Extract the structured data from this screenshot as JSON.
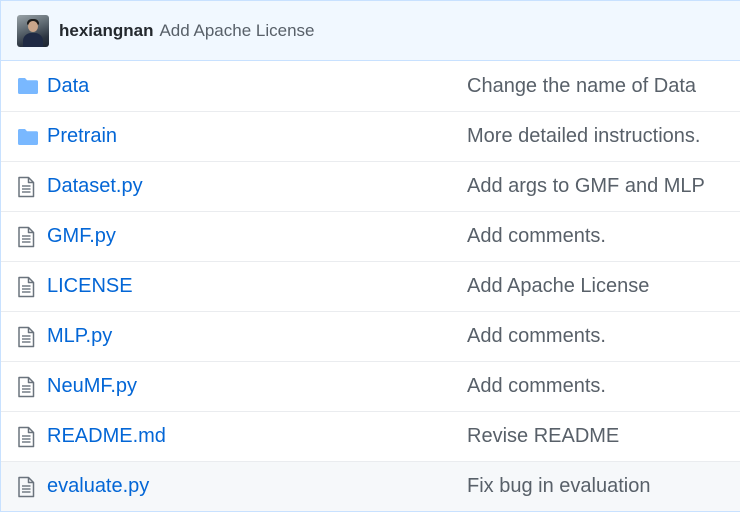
{
  "commit": {
    "author": "hexiangnan",
    "message": "Add Apache License"
  },
  "colors": {
    "link": "#0366d6",
    "folder_icon": "#79b8ff",
    "file_icon": "#6a737d",
    "header_bg": "#f1f8ff"
  },
  "files": [
    {
      "name": "Data",
      "type": "folder",
      "icon": "folder-icon",
      "message": "Change the name of Data"
    },
    {
      "name": "Pretrain",
      "type": "folder",
      "icon": "folder-icon",
      "message": "More detailed instructions."
    },
    {
      "name": "Dataset.py",
      "type": "file",
      "icon": "file-icon",
      "message": "Add args to GMF and MLP"
    },
    {
      "name": "GMF.py",
      "type": "file",
      "icon": "file-icon",
      "message": "Add comments."
    },
    {
      "name": "LICENSE",
      "type": "file",
      "icon": "file-icon",
      "message": "Add Apache License"
    },
    {
      "name": "MLP.py",
      "type": "file",
      "icon": "file-icon",
      "message": "Add comments."
    },
    {
      "name": "NeuMF.py",
      "type": "file",
      "icon": "file-icon",
      "message": "Add comments."
    },
    {
      "name": "README.md",
      "type": "file",
      "icon": "file-icon",
      "message": "Revise README"
    },
    {
      "name": "evaluate.py",
      "type": "file",
      "icon": "file-icon",
      "message": "Fix bug in evaluation"
    }
  ]
}
